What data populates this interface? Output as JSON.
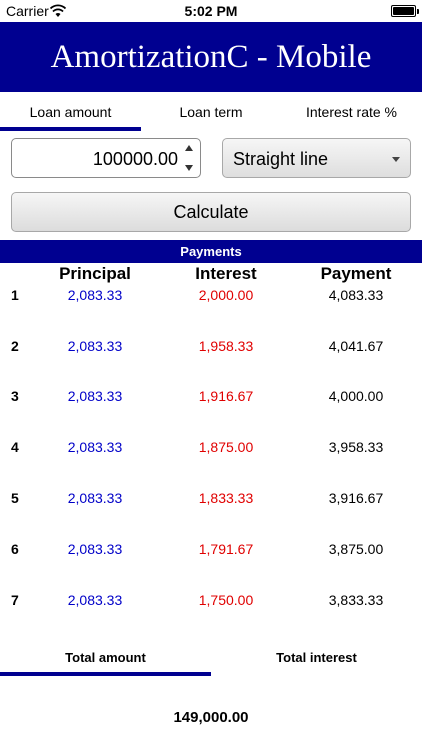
{
  "status_bar": {
    "carrier": "Carrier",
    "time": "5:02 PM"
  },
  "header": {
    "title": "AmortizationC - Mobile"
  },
  "tabs": [
    {
      "label": "Loan amount",
      "active": true
    },
    {
      "label": "Loan term",
      "active": false
    },
    {
      "label": "Interest rate %",
      "active": false
    }
  ],
  "inputs": {
    "loan_amount": "100000.00",
    "method": "Straight line",
    "calculate_label": "Calculate"
  },
  "payments": {
    "title": "Payments",
    "columns": [
      "Principal",
      "Interest",
      "Payment"
    ],
    "rows": [
      {
        "n": "1",
        "principal": "2,083.33",
        "interest": "2,000.00",
        "payment": "4,083.33"
      },
      {
        "n": "2",
        "principal": "2,083.33",
        "interest": "1,958.33",
        "payment": "4,041.67"
      },
      {
        "n": "3",
        "principal": "2,083.33",
        "interest": "1,916.67",
        "payment": "4,000.00"
      },
      {
        "n": "4",
        "principal": "2,083.33",
        "interest": "1,875.00",
        "payment": "3,958.33"
      },
      {
        "n": "5",
        "principal": "2,083.33",
        "interest": "1,833.33",
        "payment": "3,916.67"
      },
      {
        "n": "6",
        "principal": "2,083.33",
        "interest": "1,791.67",
        "payment": "3,875.00"
      },
      {
        "n": "7",
        "principal": "2,083.33",
        "interest": "1,750.00",
        "payment": "3,833.33"
      }
    ]
  },
  "totals": {
    "tabs": [
      {
        "label": "Total amount",
        "active": true
      },
      {
        "label": "Total interest",
        "active": false
      }
    ],
    "value": "149,000.00"
  },
  "colors": {
    "brand_navy": "#000090",
    "principal_blue": "#0000c8",
    "interest_red": "#e00000"
  }
}
